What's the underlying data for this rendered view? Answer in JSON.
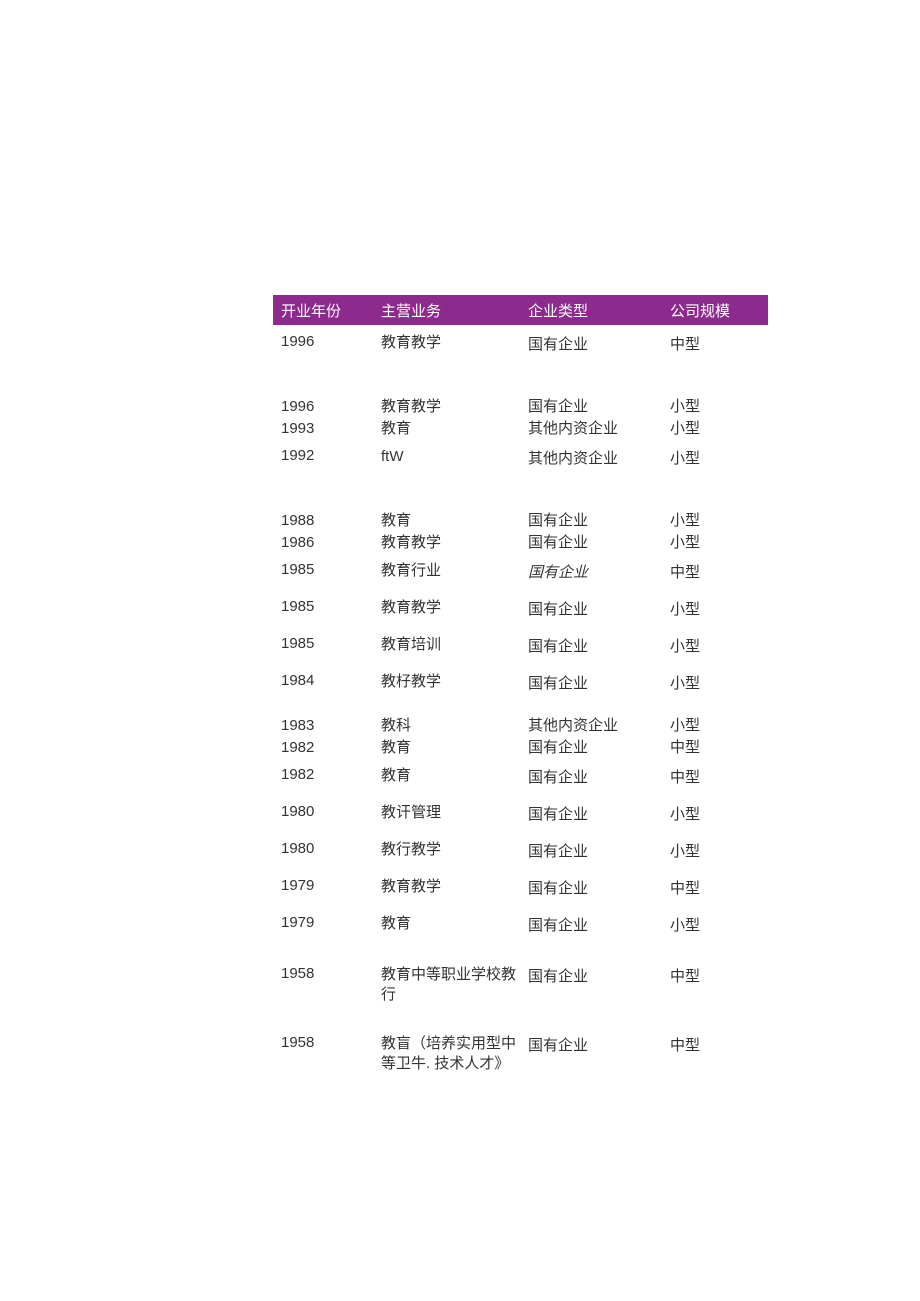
{
  "headers": {
    "year": "开业年份",
    "business": "主营业务",
    "type": "企业类型",
    "size": "公司规模"
  },
  "rows": [
    {
      "year": "1996",
      "business": "教育教学",
      "type": "国有企业",
      "size": "中型",
      "spacing": "large-after"
    },
    {
      "year": "1996",
      "business": "教育教学",
      "type": "国有企业",
      "size": "小型",
      "spacing": "tight"
    },
    {
      "year": "1993",
      "business": "教育",
      "type": "其他内资企业",
      "size": "小型",
      "spacing": "tight"
    },
    {
      "year": "1992",
      "business": "ftW",
      "type": "其他内资企业",
      "size": "小型",
      "spacing": "large-after"
    },
    {
      "year": "1988",
      "business": "教育",
      "type": "国有企业",
      "size": "小型",
      "spacing": "tight"
    },
    {
      "year": "1986",
      "business": "教育教学",
      "type": "国有企业",
      "size": "小型",
      "spacing": "tight"
    },
    {
      "year": "1985",
      "business": "教育行业",
      "type": "国有企业",
      "type_style": "italic",
      "size": "中型",
      "spacing": "normal"
    },
    {
      "year": "1985",
      "business": "教育教学",
      "type": "国有企业",
      "size": "小型",
      "spacing": "normal"
    },
    {
      "year": "1985",
      "business": "教育培训",
      "type": "国有企业",
      "size": "小型",
      "spacing": "normal"
    },
    {
      "year": "1984",
      "business": "教杍教学",
      "type": "国有企业",
      "size": "小型",
      "spacing": "med-after"
    },
    {
      "year": "1983",
      "business": "教科",
      "type": "其他内资企业",
      "size": "小型",
      "spacing": "tight"
    },
    {
      "year": "1982",
      "business": "教育",
      "type": "国有企业",
      "size": "中型",
      "spacing": "tight"
    },
    {
      "year": "1982",
      "business": "教育",
      "type": "国有企业",
      "size": "中型",
      "spacing": "normal"
    },
    {
      "year": "1980",
      "business": "教讦管理",
      "type": "国有企业",
      "size": "小型",
      "spacing": "normal"
    },
    {
      "year": "1980",
      "business": "教行教学",
      "type": "国有企业",
      "size": "小型",
      "spacing": "normal"
    },
    {
      "year": "1979",
      "business": "教育教学",
      "type": "国有企业",
      "size": "中型",
      "spacing": "normal"
    },
    {
      "year": "1979",
      "business": "教育",
      "type": "国有企业",
      "size": "小型",
      "spacing": "med-after"
    },
    {
      "year": "1958",
      "business": "教育中等职业学校教行",
      "type": "国有企业",
      "size": "中型",
      "spacing": "med-after"
    },
    {
      "year": "1958",
      "business": "教盲（培养实用型中等卫牛. 技术人才》",
      "type": "国有企业",
      "size": "中型",
      "spacing": "normal"
    }
  ]
}
